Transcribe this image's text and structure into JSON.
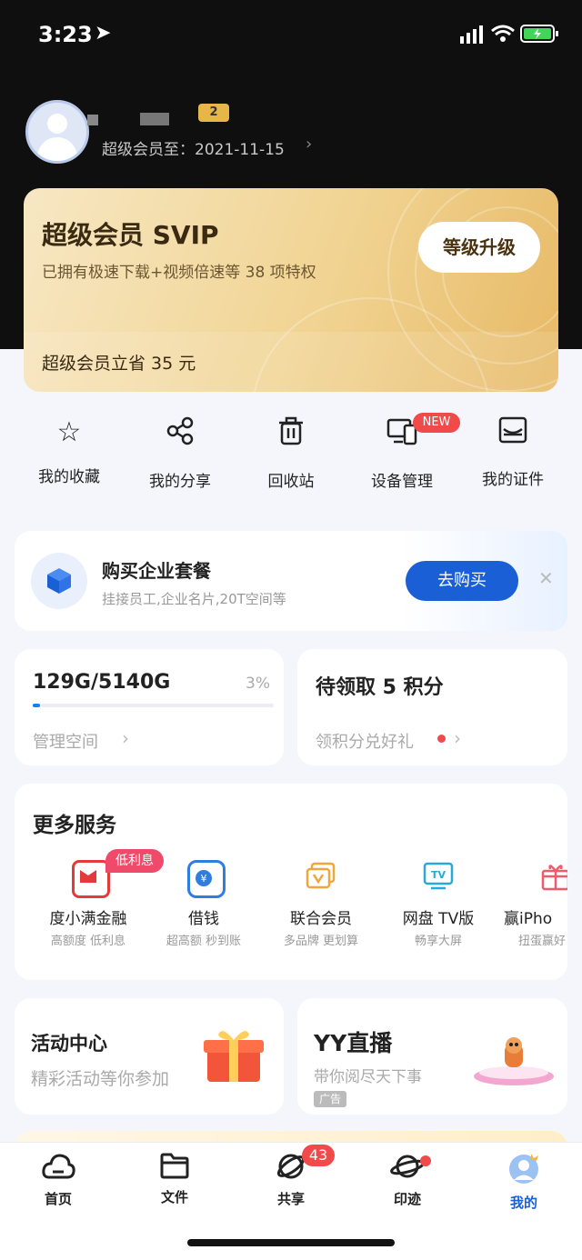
{
  "status_bar": {
    "time": "3:23"
  },
  "profile": {
    "badge_level": "2",
    "expiry_label": "超级会员至：2021-11-15"
  },
  "svip": {
    "title": "超级会员 SVIP",
    "subtitle": "已拥有极速下载+视频倍速等 38 项特权",
    "upgrade_button": "等级升级",
    "save_text": "超级会员立省 35 元"
  },
  "quick_actions": [
    {
      "label": "我的收藏",
      "icon": "star-icon"
    },
    {
      "label": "我的分享",
      "icon": "share-icon"
    },
    {
      "label": "回收站",
      "icon": "trash-icon"
    },
    {
      "label": "设备管理",
      "icon": "devices-icon",
      "badge": "NEW"
    },
    {
      "label": "我的证件",
      "icon": "id-card-icon"
    }
  ],
  "enterprise": {
    "title": "购买企业套餐",
    "subtitle": "挂接员工,企业名片,20T空间等",
    "button": "去购买"
  },
  "storage": {
    "usage": "129G/5140G",
    "percent": "3%",
    "percent_value": 0.03,
    "manage_link": "管理空间"
  },
  "points": {
    "title": "待领取 5 积分",
    "link": "领积分兑好礼"
  },
  "services": {
    "title": "更多服务",
    "items": [
      {
        "name": "度小满金融",
        "sub": "高额度 低利息",
        "badge": "低利息",
        "color": "#e33b3b"
      },
      {
        "name": "借钱",
        "sub": "超高额 秒到账",
        "color": "#2f7de1"
      },
      {
        "name": "联合会员",
        "sub": "多品牌 更划算",
        "color": "#f0a73a"
      },
      {
        "name": "网盘 TV版",
        "sub": "畅享大屏",
        "color": "#2aa8d8"
      },
      {
        "name": "赢iPho",
        "sub": "扭蛋赢好",
        "color": "#f05a6a"
      }
    ]
  },
  "activity": {
    "title": "活动中心",
    "subtitle": "精彩活动等你参加"
  },
  "yy": {
    "title": "YY直播",
    "subtitle": "带你阅尽天下事",
    "ad_label": "广告"
  },
  "bottom_nav": [
    {
      "label": "首页",
      "icon": "cloud-home-icon"
    },
    {
      "label": "文件",
      "icon": "folder-icon"
    },
    {
      "label": "共享",
      "icon": "share-orbit-icon",
      "badge": "43"
    },
    {
      "label": "印迹",
      "icon": "planet-icon"
    },
    {
      "label": "我的",
      "icon": "profile-icon",
      "active": true
    }
  ],
  "colors": {
    "accent": "#1a5fd6",
    "gold": "#f1d493",
    "badge_red": "#f04a4a"
  }
}
